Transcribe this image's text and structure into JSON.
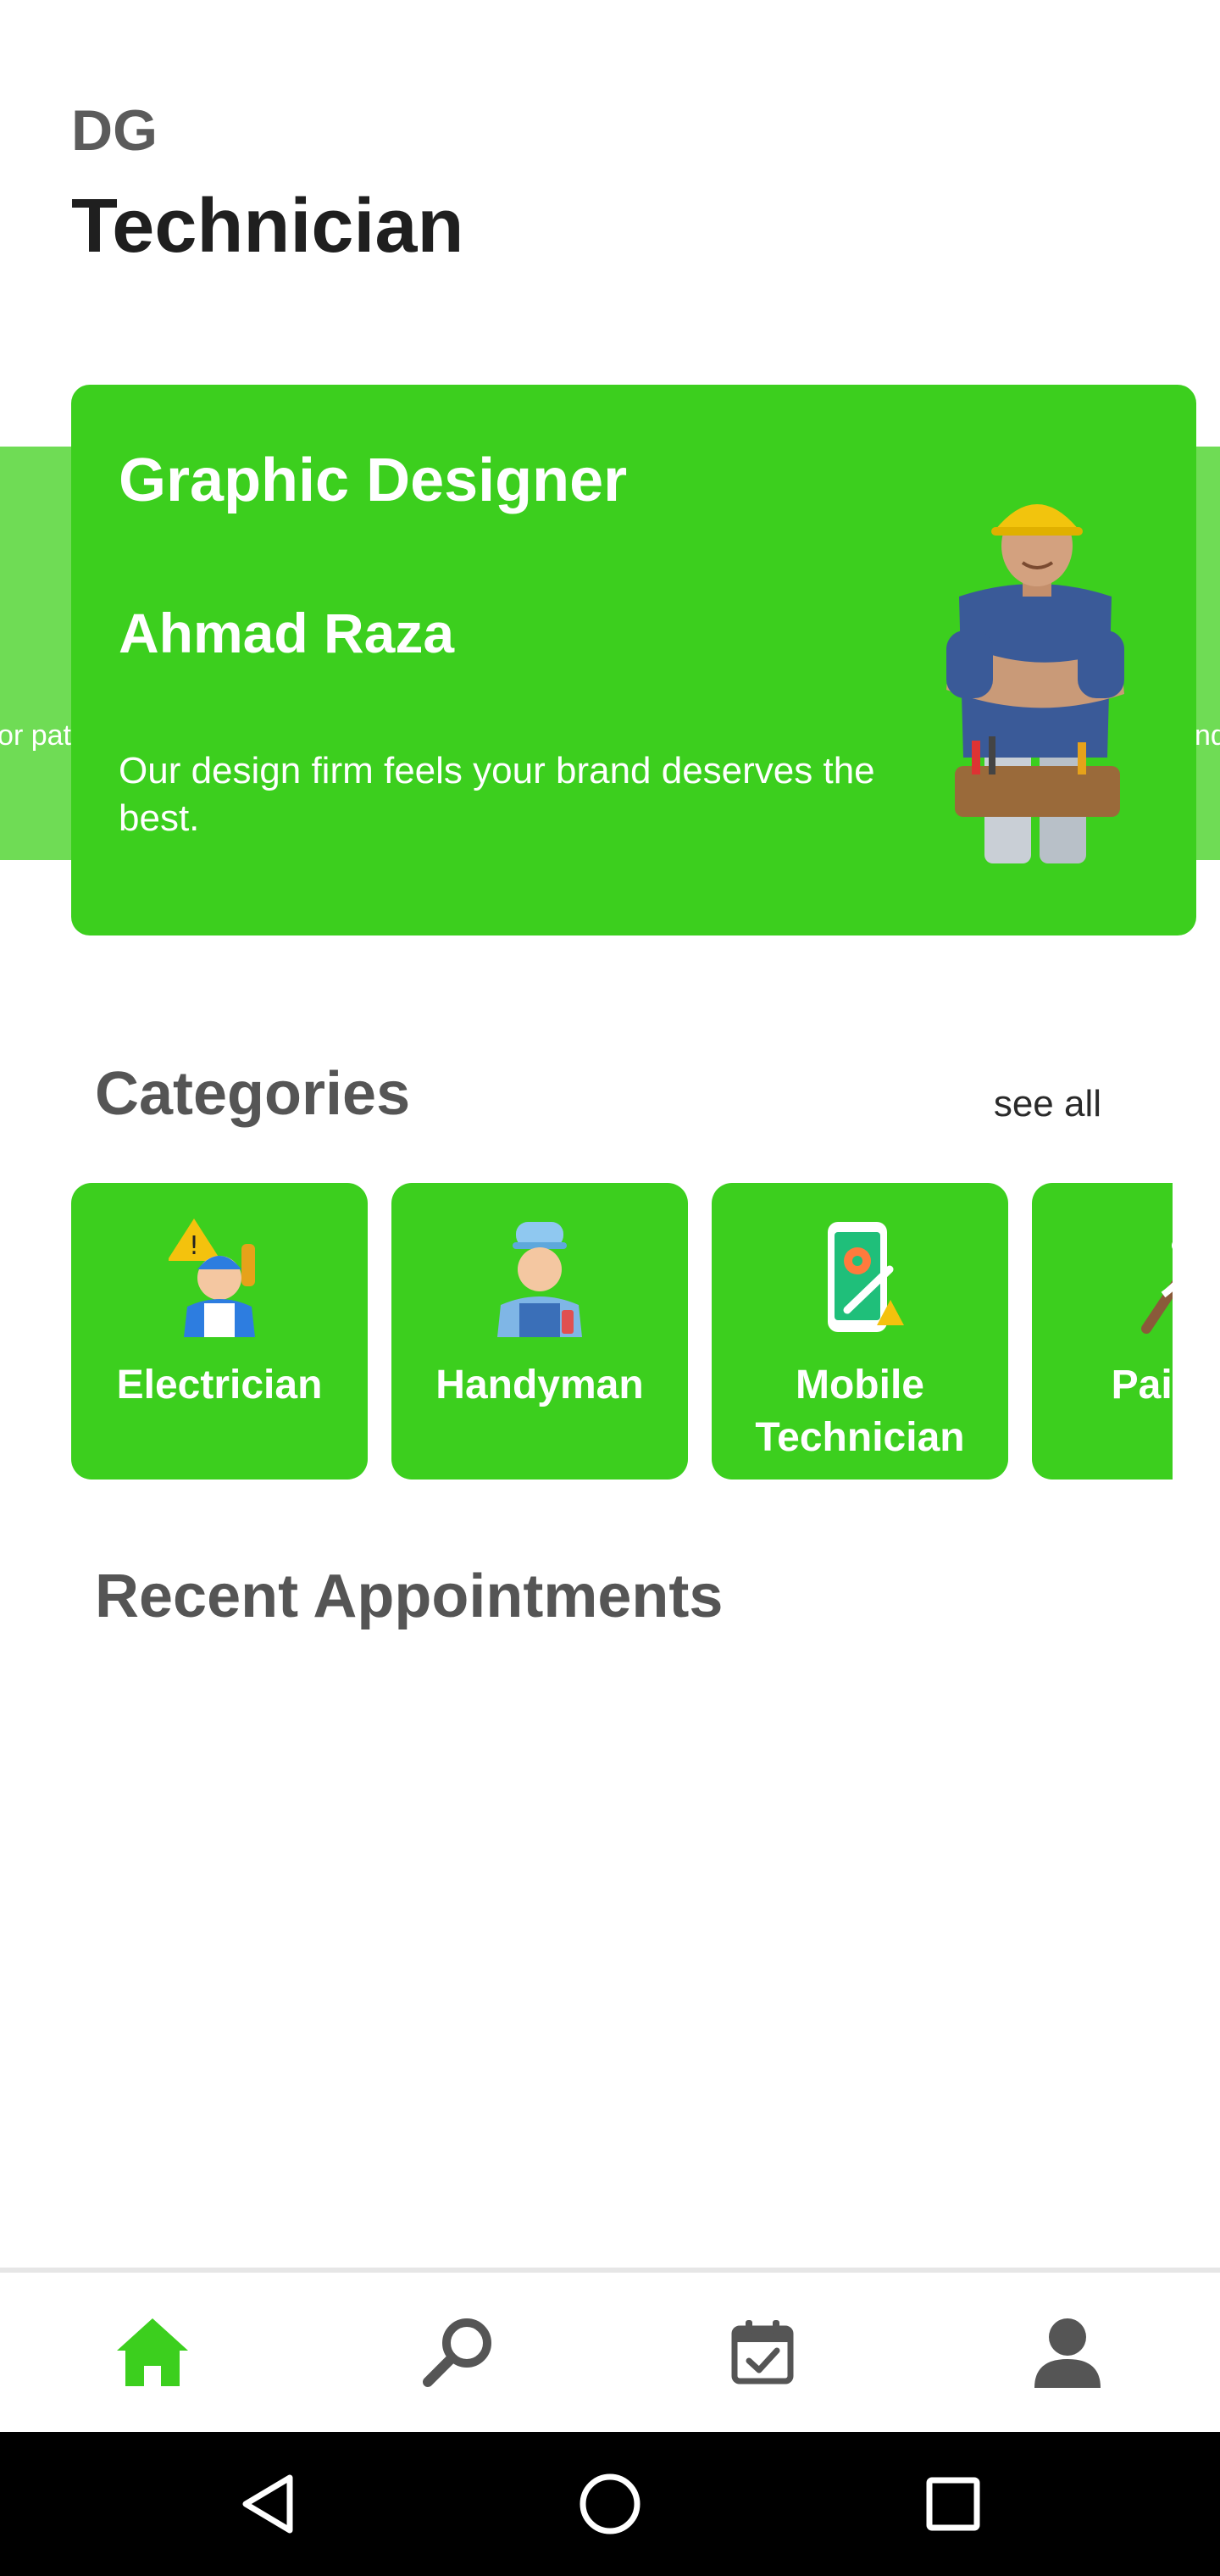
{
  "header": {
    "brand_small": "DG",
    "brand_big": "Technician"
  },
  "carousel": {
    "prev_snippet": "or pat",
    "next_snippet": "nd",
    "active": {
      "title": "Graphic Designer",
      "name": "Ahmad Raza",
      "description": "Our design firm feels your brand deserves the best.",
      "image": "technician-with-hard-hat"
    }
  },
  "categories": {
    "title": "Categories",
    "see_all": "see all",
    "items": [
      {
        "label": "Electrician",
        "icon": "electrician-icon"
      },
      {
        "label": "Handyman",
        "icon": "handyman-icon"
      },
      {
        "label": "Mobile Technician",
        "icon": "mobile-repair-icon"
      },
      {
        "label": "Painter",
        "icon": "paint-roller-icon"
      }
    ]
  },
  "recent": {
    "title": "Recent Appointments"
  },
  "bottom_nav": {
    "items": [
      {
        "name": "home",
        "icon": "home-icon",
        "active": true
      },
      {
        "name": "search",
        "icon": "search-icon",
        "active": false
      },
      {
        "name": "appointments",
        "icon": "calendar-check-icon",
        "active": false
      },
      {
        "name": "profile",
        "icon": "user-icon",
        "active": false
      }
    ]
  },
  "colors": {
    "accent": "#3ccf1e",
    "accent_light": "#6fdc55",
    "inactive_icon": "#555555"
  }
}
